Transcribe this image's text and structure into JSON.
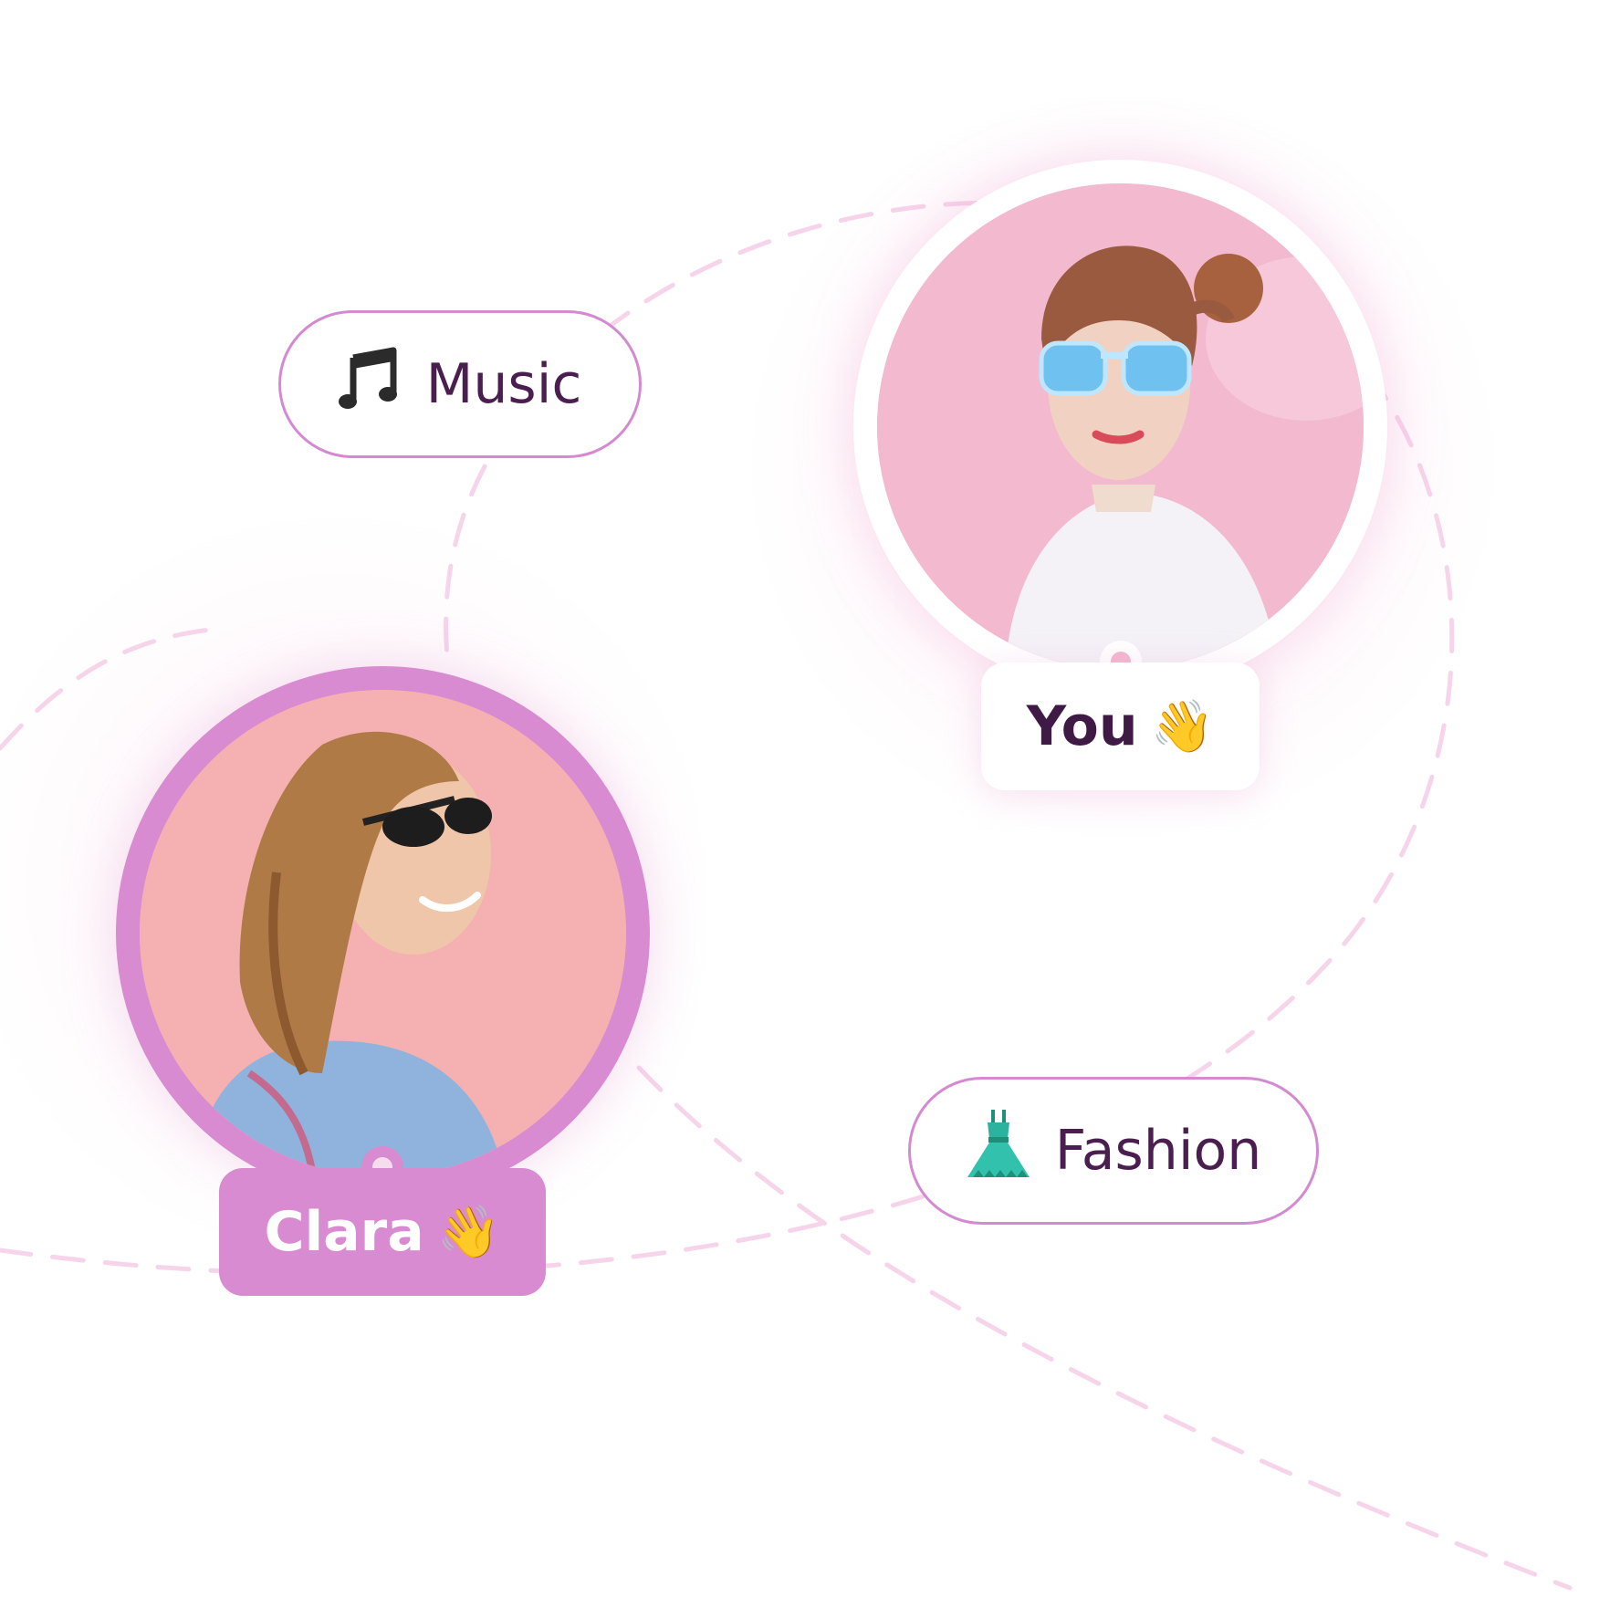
{
  "chips": [
    {
      "label": "Music",
      "icon": "music-note-icon"
    },
    {
      "label": "Fashion",
      "icon": "dress-icon"
    }
  ],
  "people": [
    {
      "name": "You",
      "icon": "waving-hand-icon",
      "emoji": "👋"
    },
    {
      "name": "Clara",
      "icon": "waving-hand-icon",
      "emoji": "👋"
    }
  ],
  "colors": {
    "accent": "#d98bd1",
    "chip_border": "#d48ad0",
    "text": "#4a1f4f",
    "dashed_line": "#f6d4ea"
  }
}
